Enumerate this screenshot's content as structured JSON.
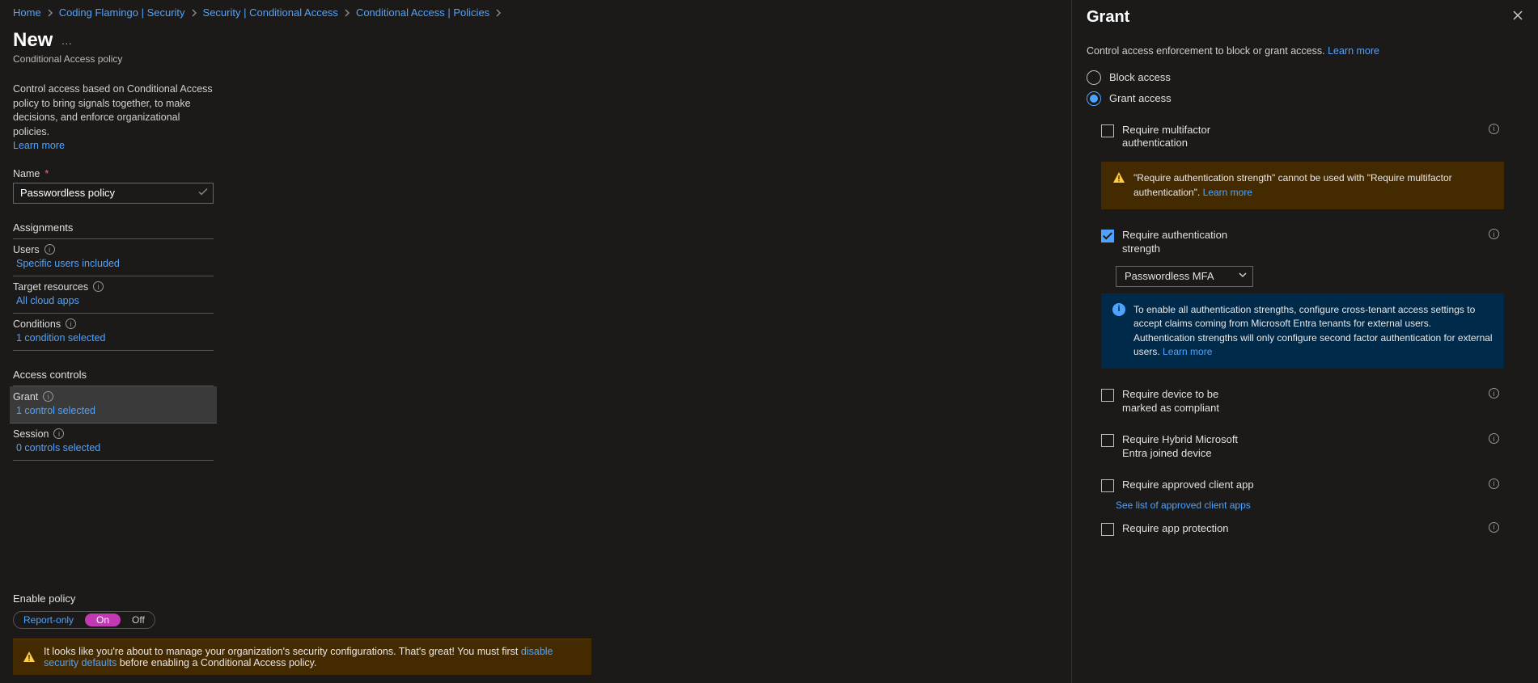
{
  "breadcrumbs": {
    "items": [
      "Home",
      "Coding Flamingo | Security",
      "Security | Conditional Access",
      "Conditional Access | Policies"
    ]
  },
  "page": {
    "title": "New",
    "subtitle": "Conditional Access policy",
    "desc": "Control access based on Conditional Access policy to bring signals together, to make decisions, and enforce organizational policies.",
    "learn_more": "Learn more"
  },
  "form": {
    "name_label": "Name",
    "name_value": "Passwordless policy",
    "assignments_head": "Assignments",
    "users_label": "Users",
    "users_link": "Specific users included",
    "target_label": "Target resources",
    "target_link": "All cloud apps",
    "conditions_label": "Conditions",
    "conditions_link": "1 condition selected",
    "access_head": "Access controls",
    "grant_label": "Grant",
    "grant_link": "1 control selected",
    "session_label": "Session",
    "session_link": "0 controls selected"
  },
  "bottom": {
    "enable_label": "Enable policy",
    "opt_report": "Report-only",
    "opt_on": "On",
    "opt_off": "Off",
    "warn_pre": "It looks like you're about to manage your organization's security configurations. That's great! You must first ",
    "warn_link": "disable security defaults",
    "warn_post": " before enabling a Conditional Access policy."
  },
  "panel": {
    "title": "Grant",
    "desc": "Control access enforcement to block or grant access. ",
    "learn_more": "Learn more",
    "radio_block": "Block access",
    "radio_grant": "Grant access",
    "chk_mfa": "Require multifactor authentication",
    "warn_mfa": "\"Require authentication strength\" cannot be used with \"Require multifactor authentication\". ",
    "chk_strength": "Require authentication strength",
    "strength_value": "Passwordless MFA",
    "info_strength": "To enable all authentication strengths, configure cross-tenant access settings to accept claims coming from Microsoft Entra tenants for external users. Authentication strengths will only configure second factor authentication for external users. ",
    "chk_compliant": "Require device to be marked as compliant",
    "chk_hybrid": "Require Hybrid Microsoft Entra joined device",
    "chk_approved": "Require approved client app",
    "see_list": "See list of approved client apps",
    "chk_protection": "Require app protection"
  }
}
